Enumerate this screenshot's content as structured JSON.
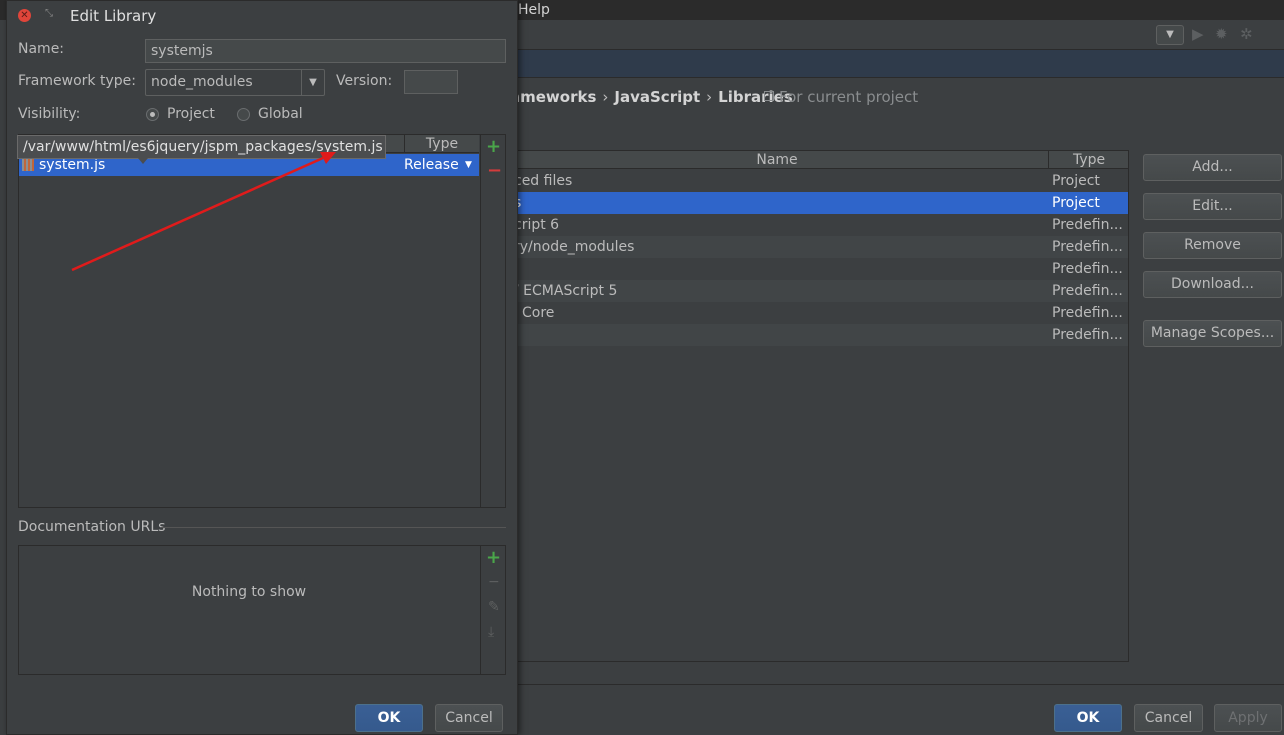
{
  "ide": {
    "menu_help": "Help",
    "breadcrumb": [
      "ameworks",
      "JavaScript",
      "Libraries"
    ],
    "breadcrumb_note": "For current project",
    "libraries_table": {
      "headers": {
        "name": "Name",
        "type": "Type"
      },
      "rows": [
        {
          "name": "ced files",
          "type": "Project"
        },
        {
          "name": "s",
          "type": "Project"
        },
        {
          "name": "cript 6",
          "type": "Predefin..."
        },
        {
          "name": "ry/node_modules",
          "type": "Predefin..."
        },
        {
          "name": "",
          "type": "Predefin..."
        },
        {
          "name": "/ ECMAScript 5",
          "type": "Predefin..."
        },
        {
          "name": "Core",
          "type": "Predefin..."
        },
        {
          "name": "",
          "type": "Predefin..."
        }
      ]
    },
    "buttons": {
      "add": "Add...",
      "edit": "Edit...",
      "remove": "Remove",
      "download": "Download...",
      "manage_scopes": "Manage Scopes...",
      "ok": "OK",
      "cancel": "Cancel",
      "apply": "Apply"
    }
  },
  "dialog": {
    "title": "Edit Library",
    "name_label": "Name:",
    "name_value": "systemjs",
    "framework_label": "Framework type:",
    "framework_value": "node_modules",
    "version_label": "Version:",
    "version_value": "",
    "visibility_label": "Visibility:",
    "visibility_options": [
      "Project",
      "Global"
    ],
    "visibility_selected": "Project",
    "files_table": {
      "type_header": "Type",
      "rows": [
        {
          "name": "system.js",
          "type": "Release"
        }
      ]
    },
    "tooltip": "/var/www/html/es6jquery/jspm_packages/system.js",
    "doc_urls_label": "Documentation URLs",
    "doc_urls_empty": "Nothing to show",
    "ok": "OK",
    "cancel": "Cancel"
  },
  "colors": {
    "selection": "#2f65ca",
    "annotation_arrow": "#e01b1b",
    "add_icon": "#4aa64a",
    "remove_icon": "#d33c3c"
  },
  "icons": [
    "close-icon",
    "restore-icon",
    "play-icon",
    "debug-icon",
    "settings-icon",
    "library-jar-icon",
    "add-icon",
    "remove-icon",
    "edit-icon",
    "download-icon"
  ]
}
